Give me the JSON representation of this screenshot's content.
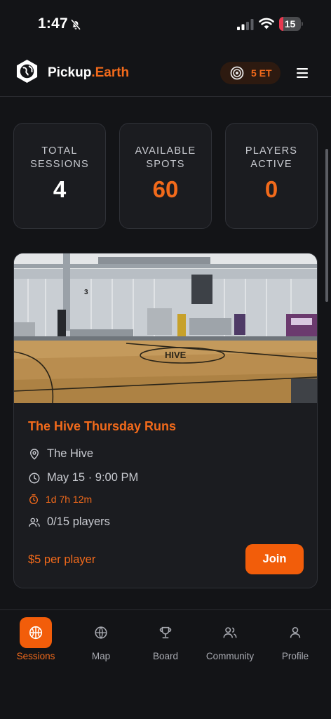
{
  "status_bar": {
    "time": "1:47",
    "battery": "15",
    "battery_level": 0.15,
    "icons": [
      "bell-slash-icon",
      "signal-icon",
      "wifi-icon",
      "battery-icon"
    ]
  },
  "header": {
    "brand_main": "Pickup",
    "brand_suffix": ".Earth",
    "token_balance": "5 ET",
    "icons": [
      "globe-logo-icon",
      "token-coin-icon",
      "menu-icon"
    ]
  },
  "stats": [
    {
      "label": "TOTAL SESSIONS",
      "value": "4"
    },
    {
      "label": "AVAILABLE SPOTS",
      "value": "60"
    },
    {
      "label": "PLAYERS ACTIVE",
      "value": "0"
    }
  ],
  "session": {
    "title": "The Hive Thursday Runs",
    "location": "The Hive",
    "datetime": "May 15 · 9:00 PM",
    "countdown": "1d 7h 12m",
    "players": "0/15 players",
    "price": "$5 per player",
    "join_label": "Join"
  },
  "nav": {
    "items": [
      {
        "label": "Sessions",
        "icon": "basketball-icon",
        "active": true
      },
      {
        "label": "Map",
        "icon": "globe-icon",
        "active": false
      },
      {
        "label": "Board",
        "icon": "trophy-icon",
        "active": false
      },
      {
        "label": "Community",
        "icon": "users-icon",
        "active": false
      },
      {
        "label": "Profile",
        "icon": "user-icon",
        "active": false
      }
    ]
  },
  "colors": {
    "accent": "#f26a1b",
    "background": "#131417",
    "card": "#1b1c20"
  }
}
